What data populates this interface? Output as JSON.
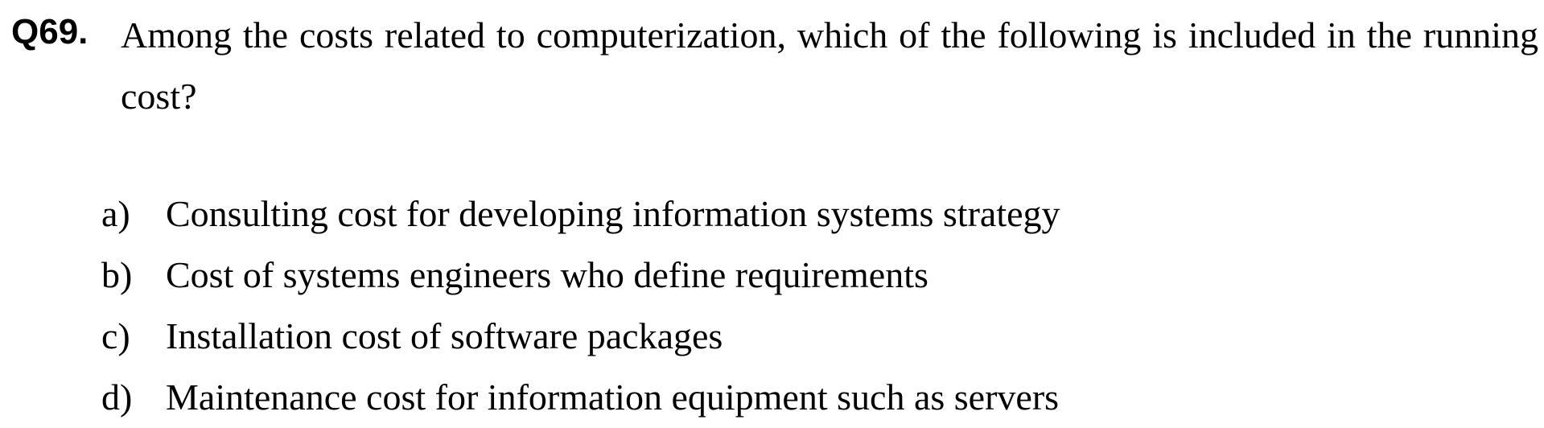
{
  "question": {
    "number": "Q69.",
    "text": "Among the costs related to computerization, which of the following is included in the running cost?"
  },
  "options": [
    {
      "label": "a)",
      "text": "Consulting cost for developing information systems strategy"
    },
    {
      "label": "b)",
      "text": "Cost of systems engineers who define requirements"
    },
    {
      "label": "c)",
      "text": "Installation cost of software packages"
    },
    {
      "label": "d)",
      "text": "Maintenance cost for information equipment such as servers"
    }
  ]
}
